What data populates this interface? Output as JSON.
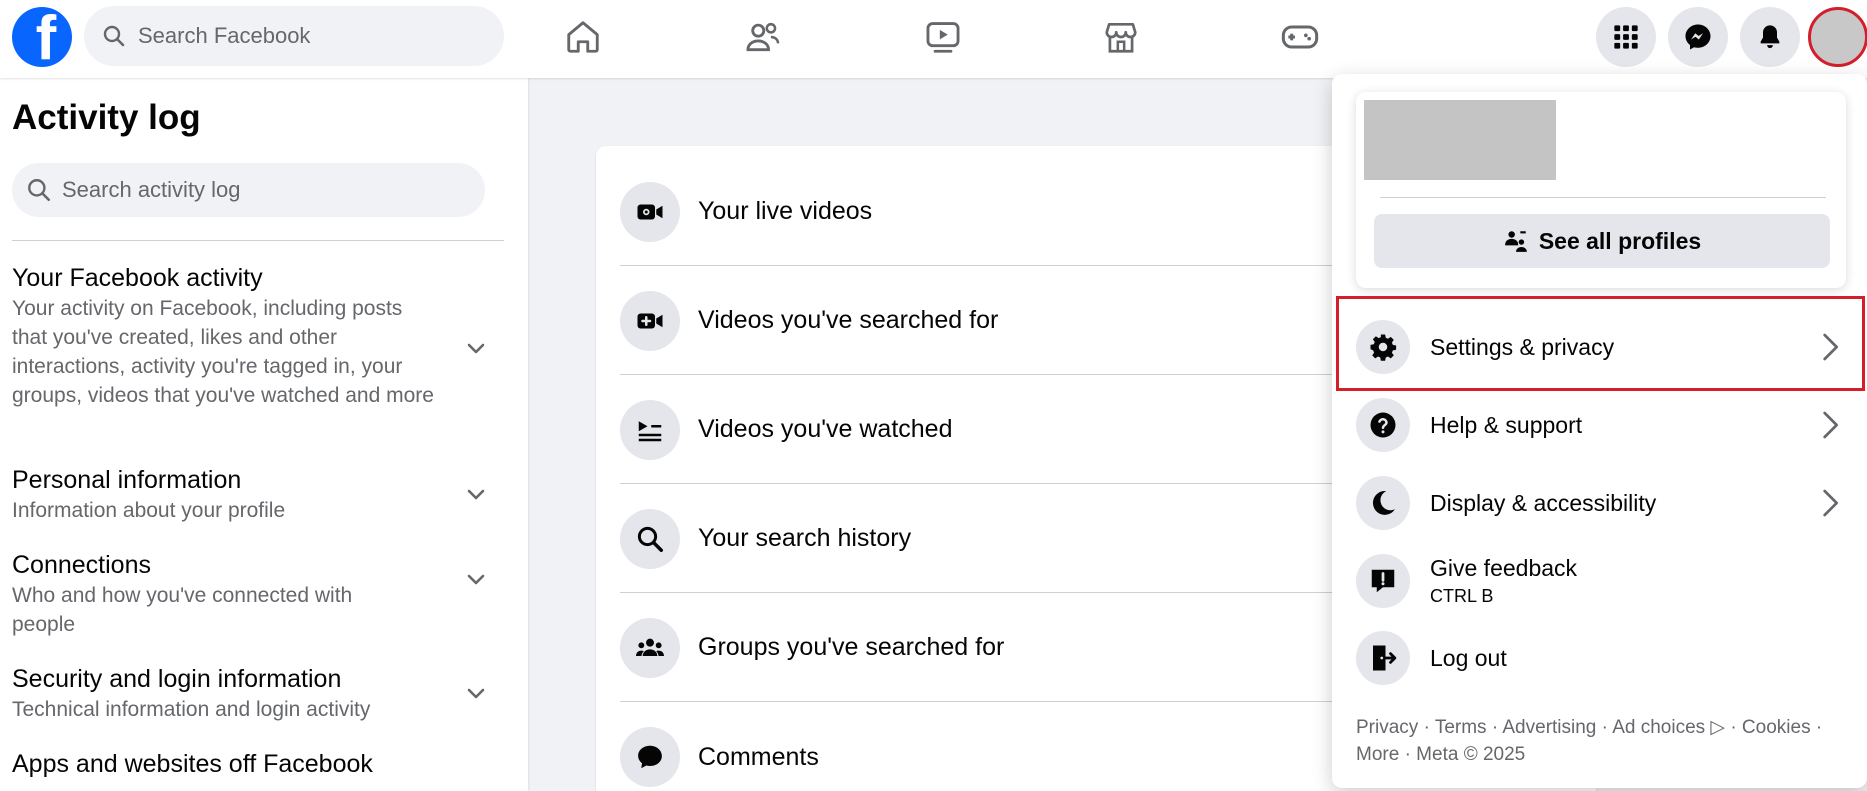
{
  "topbar": {
    "logo_letter": "f",
    "search_placeholder": "Search Facebook"
  },
  "sidebar": {
    "title": "Activity log",
    "search_placeholder": "Search activity log",
    "categories": [
      {
        "title": "Your Facebook activity",
        "desc": "Your activity on Facebook, including posts that you've created, likes and other interactions, activity you're tagged in, your groups, videos that you've watched and more"
      },
      {
        "title": "Personal information",
        "desc": "Information about your profile"
      },
      {
        "title": "Connections",
        "desc": "Who and how you've connected with people"
      },
      {
        "title": "Security and login information",
        "desc": "Technical information and login activity"
      },
      {
        "title": "Apps and websites off Facebook",
        "desc": ""
      }
    ]
  },
  "main": {
    "rows": [
      {
        "label": "Your live videos",
        "icon": "video-camera-icon"
      },
      {
        "label": "Videos you've searched for",
        "icon": "video-search-icon"
      },
      {
        "label": "Videos you've watched",
        "icon": "playlist-icon"
      },
      {
        "label": "Your search history",
        "icon": "magnifier-icon"
      },
      {
        "label": "Groups you've searched for",
        "icon": "groups-icon"
      },
      {
        "label": "Comments",
        "icon": "comment-icon"
      }
    ]
  },
  "dropdown": {
    "see_all_profiles": "See all profiles",
    "items": [
      {
        "label": "Settings & privacy",
        "sub": "",
        "icon": "gear-icon",
        "has_arrow": true
      },
      {
        "label": "Help & support",
        "sub": "",
        "icon": "question-icon",
        "has_arrow": true
      },
      {
        "label": "Display & accessibility",
        "sub": "",
        "icon": "moon-icon",
        "has_arrow": true
      },
      {
        "label": "Give feedback",
        "sub": "CTRL B",
        "icon": "feedback-icon",
        "has_arrow": false
      },
      {
        "label": "Log out",
        "sub": "",
        "icon": "logout-icon",
        "has_arrow": false
      }
    ],
    "footer_line1": "Privacy · Terms · Advertising · Ad choices ▷ · Cookies ·",
    "footer_line2": "More · Meta © 2025"
  },
  "colors": {
    "brand": "#0866ff",
    "highlight": "#d21f2b"
  }
}
